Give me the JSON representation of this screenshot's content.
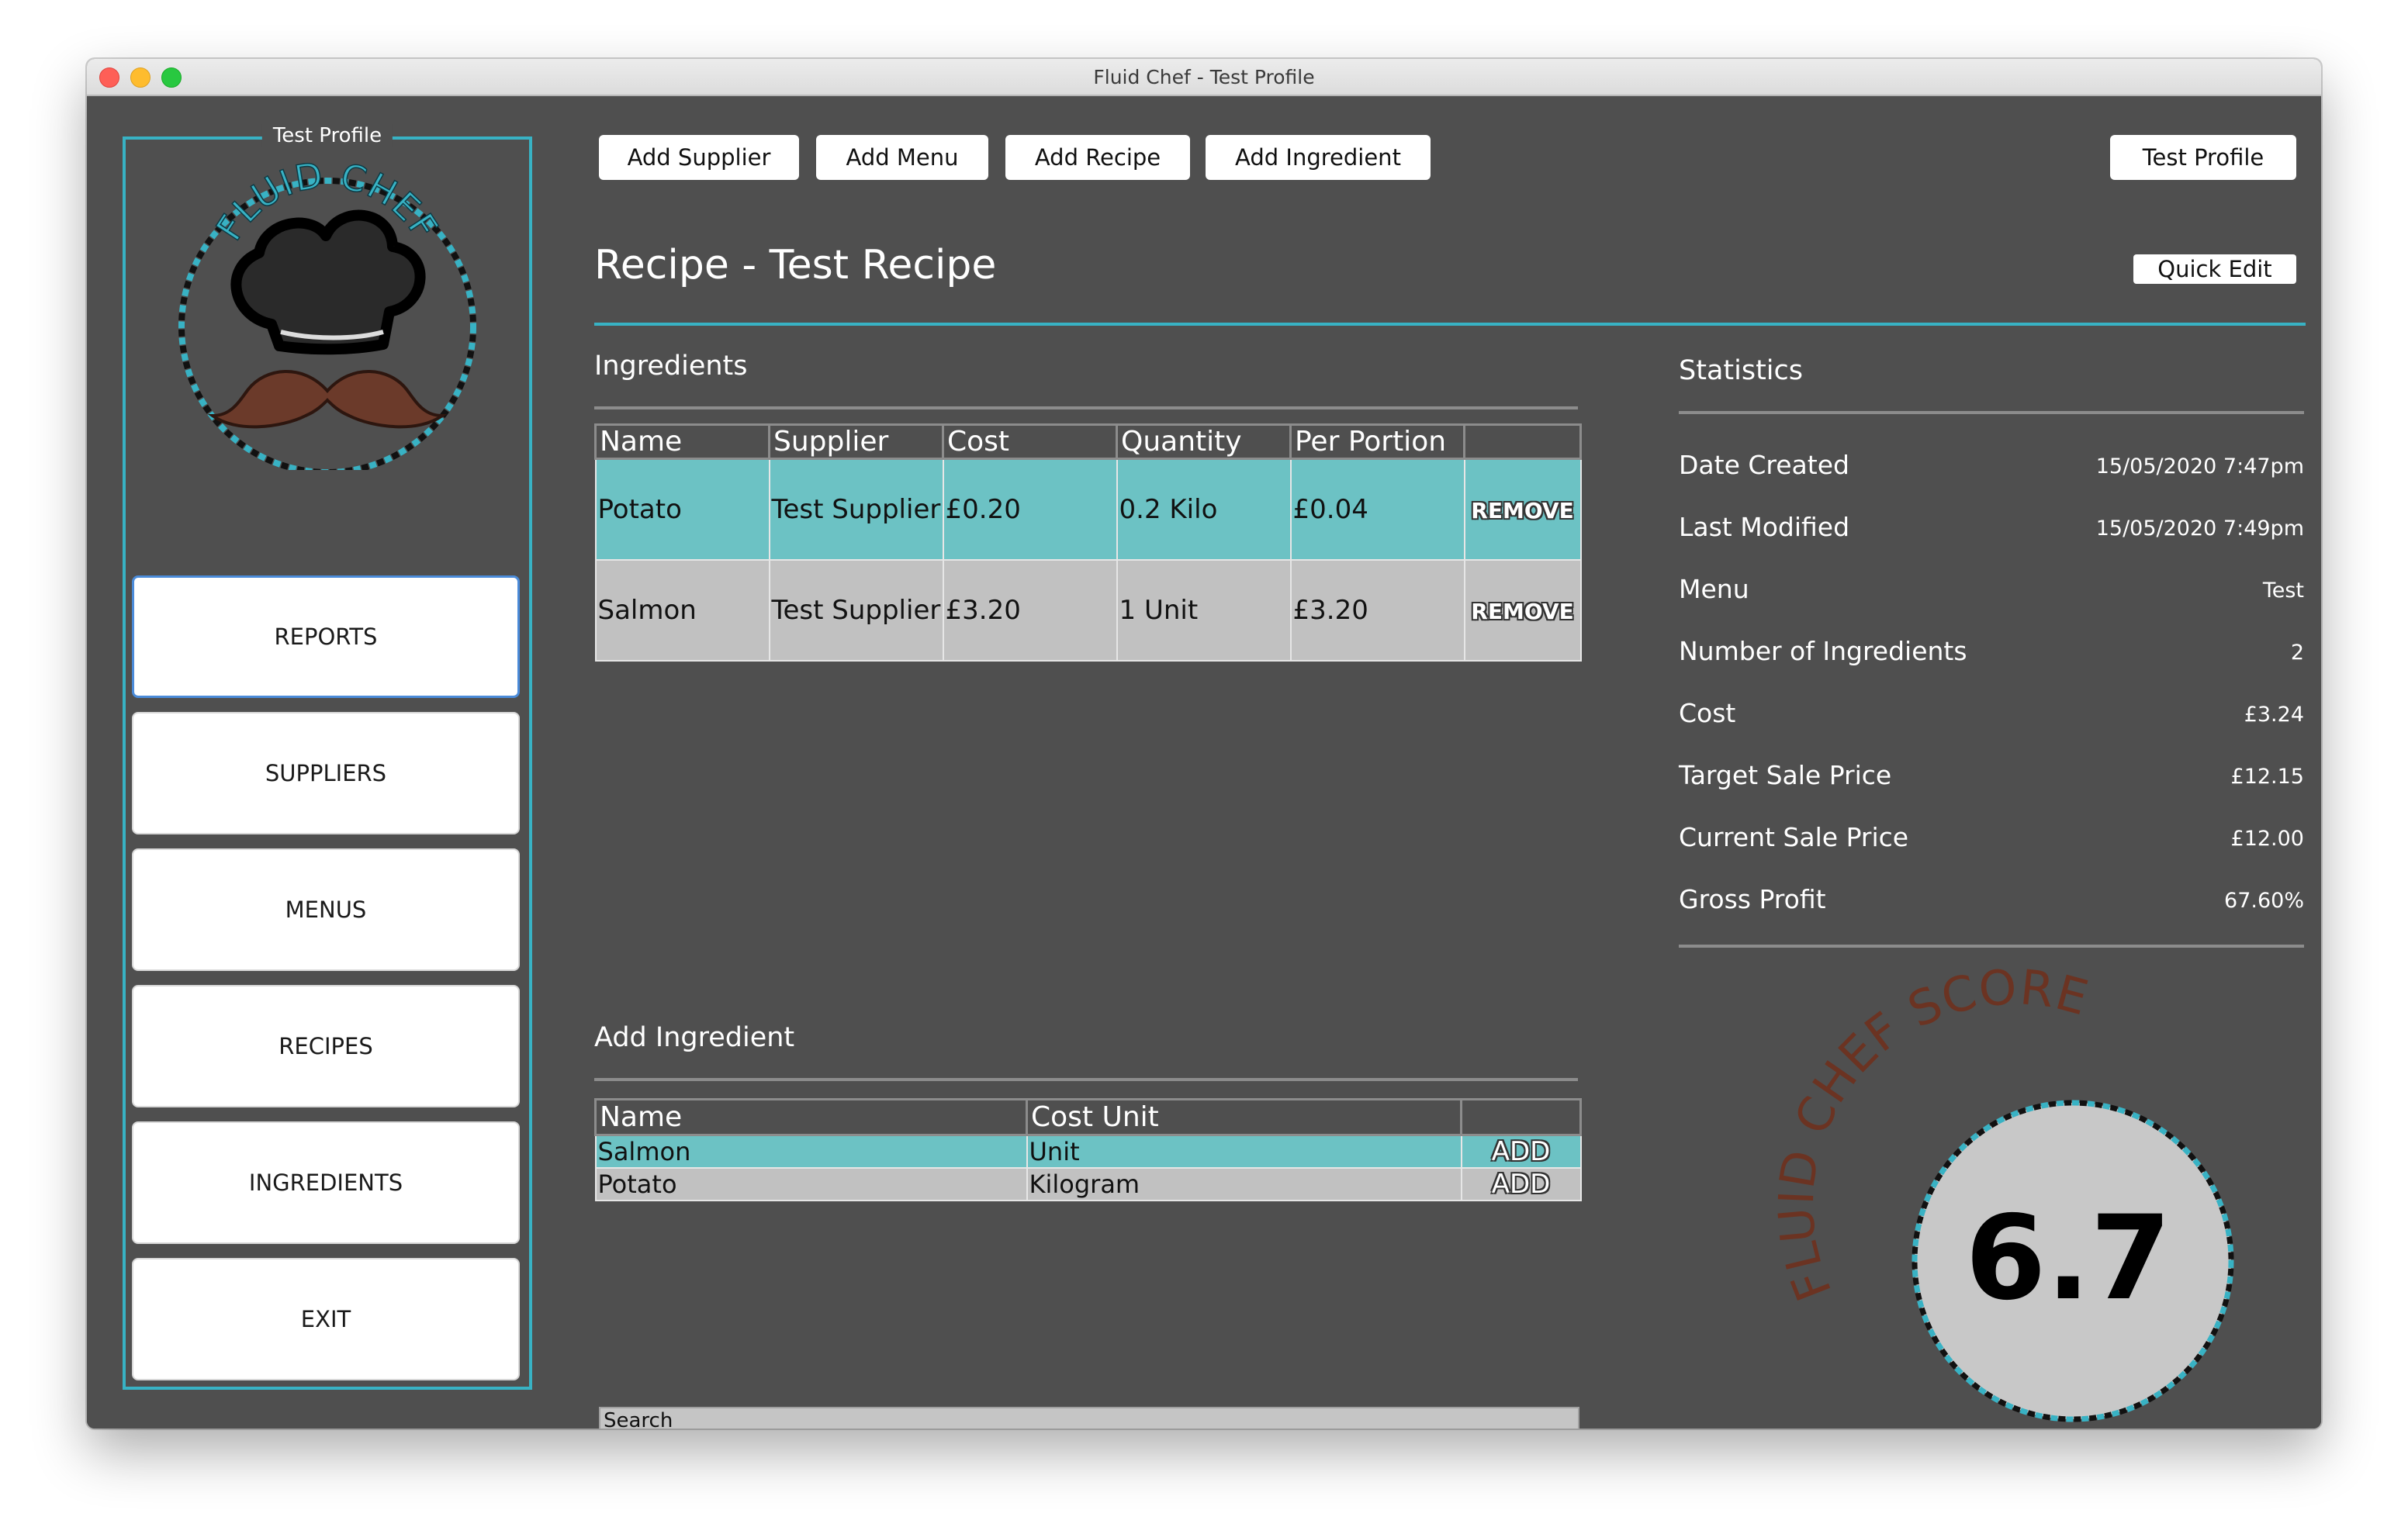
{
  "window": {
    "title": "Fluid Chef - Test Profile"
  },
  "sidebar": {
    "profile_label": "Test Profile",
    "logo_text": "FLUID CHEF",
    "nav": [
      "REPORTS",
      "SUPPLIERS",
      "MENUS",
      "RECIPES",
      "INGREDIENTS",
      "EXIT"
    ],
    "active": "REPORTS"
  },
  "toolbar": {
    "add_supplier": "Add Supplier",
    "add_menu": "Add Menu",
    "add_recipe": "Add Recipe",
    "add_ingredient": "Add Ingredient",
    "profile": "Test Profile"
  },
  "page": {
    "title": "Recipe - Test Recipe",
    "quick_edit": "Quick Edit"
  },
  "ingredients": {
    "label": "Ingredients",
    "columns": [
      "Name",
      "Supplier",
      "Cost",
      "Quantity",
      "Per Portion",
      ""
    ],
    "rows": [
      {
        "name": "Potato",
        "supplier": "Test Supplier",
        "cost": "£0.20",
        "quantity": "0.2 Kilo",
        "per_portion": "£0.04",
        "action": "REMOVE"
      },
      {
        "name": "Salmon",
        "supplier": "Test Supplier",
        "cost": "£3.20",
        "quantity": "1 Unit",
        "per_portion": "£3.20",
        "action": "REMOVE"
      }
    ]
  },
  "add_ingredient": {
    "label": "Add Ingredient",
    "columns": [
      "Name",
      "Cost Unit",
      ""
    ],
    "rows": [
      {
        "name": "Salmon",
        "cost_unit": "Unit",
        "action": "ADD"
      },
      {
        "name": "Potato",
        "cost_unit": "Kilogram",
        "action": "ADD"
      }
    ],
    "search_value": "Search"
  },
  "statistics": {
    "label": "Statistics",
    "items": [
      {
        "label": "Date Created",
        "value": "15/05/2020 7:47pm"
      },
      {
        "label": "Last Modified",
        "value": "15/05/2020 7:49pm"
      },
      {
        "label": "Menu",
        "value": "Test"
      },
      {
        "label": "Number of Ingredients",
        "value": "2"
      },
      {
        "label": "Cost",
        "value": "£3.24"
      },
      {
        "label": "Target Sale Price",
        "value": "£12.15"
      },
      {
        "label": "Current Sale Price",
        "value": "£12.00"
      },
      {
        "label": "Gross Profit",
        "value": "67.60%"
      }
    ]
  },
  "score": {
    "arc_label": "FLUID CHEF SCORE",
    "value": "6.7"
  },
  "colors": {
    "accent": "#38b2c4",
    "background": "#4f4f4f",
    "row_teal": "#6cc2c4",
    "row_grey": "#c1c1c1",
    "score_text": "#6b3322"
  }
}
